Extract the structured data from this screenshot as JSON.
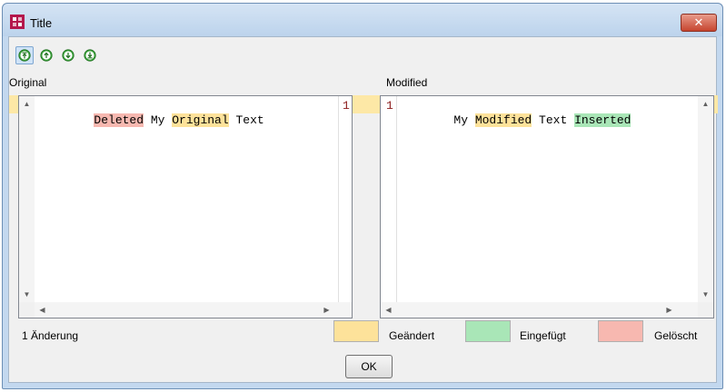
{
  "window": {
    "title": "Title"
  },
  "toolbar": {
    "buttons": [
      {
        "icon": "first-change-icon"
      },
      {
        "icon": "previous-change-icon"
      },
      {
        "icon": "next-change-icon"
      },
      {
        "icon": "last-change-icon"
      }
    ]
  },
  "panes": {
    "original": {
      "label": "Original",
      "line_number": "1",
      "tokens": [
        {
          "text": "Deleted",
          "kind": "deleted"
        },
        {
          "text": " My ",
          "kind": "plain"
        },
        {
          "text": "Original",
          "kind": "changed"
        },
        {
          "text": " Text",
          "kind": "plain"
        }
      ]
    },
    "modified": {
      "label": "Modified",
      "line_number": "1",
      "tokens": [
        {
          "text": "My ",
          "kind": "plain"
        },
        {
          "text": "Modified",
          "kind": "changed"
        },
        {
          "text": " Text ",
          "kind": "plain"
        },
        {
          "text": "Inserted",
          "kind": "inserted"
        }
      ]
    }
  },
  "status": {
    "text": "1 Änderung"
  },
  "legend": [
    {
      "label": "Geändert",
      "color": "#fde29a"
    },
    {
      "label": "Eingefügt",
      "color": "#a9e6b7"
    },
    {
      "label": "Gelöscht",
      "color": "#f7b8b0"
    }
  ],
  "buttons": {
    "ok_label": "OK"
  },
  "colors": {
    "changed_strip": "#fde8a6",
    "title_close": "#c6452f"
  }
}
